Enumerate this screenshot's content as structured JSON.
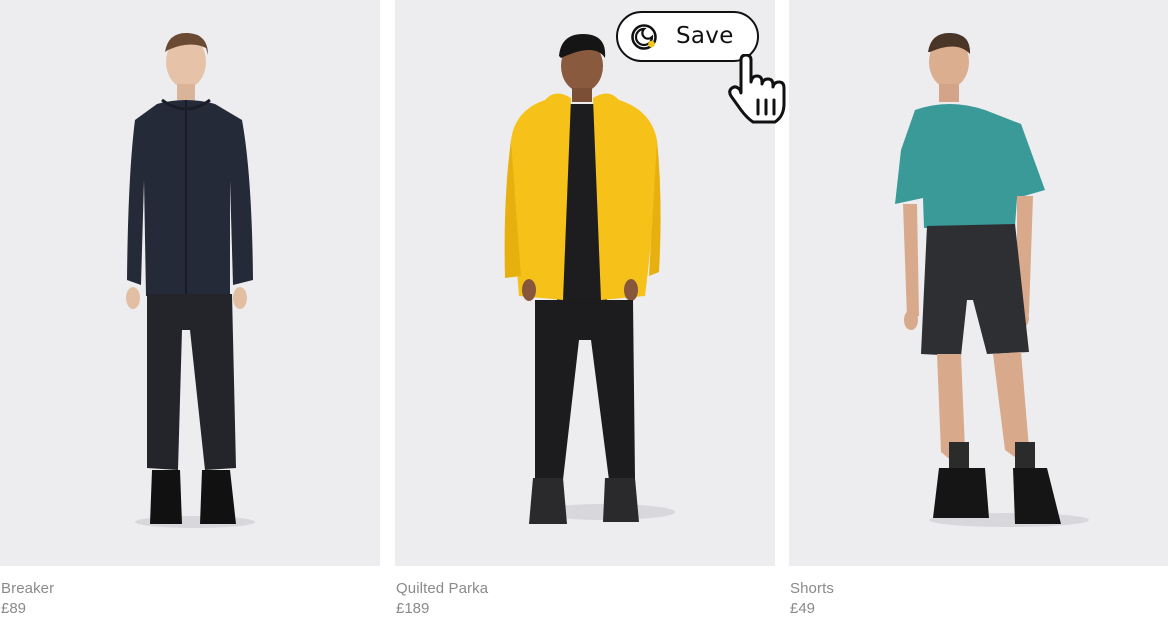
{
  "products": [
    {
      "name": "Breaker",
      "price": "£89"
    },
    {
      "name": "Quilted Parka",
      "price": "£189"
    },
    {
      "name": "Shorts",
      "price": "£49"
    }
  ],
  "save_button": {
    "label": "Save",
    "icon": "save-logo-icon",
    "accent_color": "#f5c518"
  },
  "cursor": {
    "icon": "hand-pointer-icon"
  },
  "colors": {
    "photo_background": "#ededf0",
    "text_muted": "#8a8a8a"
  }
}
